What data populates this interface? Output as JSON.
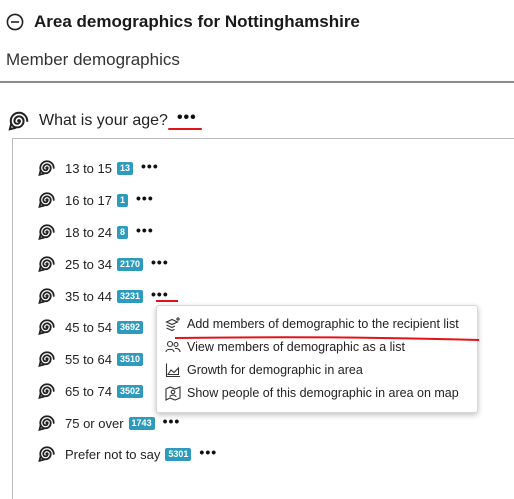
{
  "header": {
    "title": "Area demographics for Nottinghamshire",
    "collapse_icon": "minus-circle-icon"
  },
  "subtitle": "Member demographics",
  "question": {
    "text": "What is your age?",
    "more": "•••"
  },
  "items": [
    {
      "label": "13 to 15",
      "count": "13"
    },
    {
      "label": "16 to 17",
      "count": "1"
    },
    {
      "label": "18 to 24",
      "count": "8"
    },
    {
      "label": "25 to 34",
      "count": "2170"
    },
    {
      "label": "35 to 44",
      "count": "3231"
    },
    {
      "label": "45 to 54",
      "count": "3692"
    },
    {
      "label": "55 to 64",
      "count": "3510"
    },
    {
      "label": "65 to 74",
      "count": "3502"
    },
    {
      "label": "75 or over",
      "count": "1743"
    },
    {
      "label": "Prefer not to say",
      "count": "5301"
    }
  ],
  "more_label": "•••",
  "context_menu": [
    {
      "label": "Add members of demographic to the recipient list",
      "icon": "add-list-icon"
    },
    {
      "label": "View members of demographic as a list",
      "icon": "people-icon"
    },
    {
      "label": "Growth for demographic in area",
      "icon": "area-chart-icon"
    },
    {
      "label": "Show people of this demographic in area on map",
      "icon": "map-people-icon"
    }
  ],
  "colors": {
    "badge": "#2e9bbd",
    "annotation": "#e0141a"
  }
}
